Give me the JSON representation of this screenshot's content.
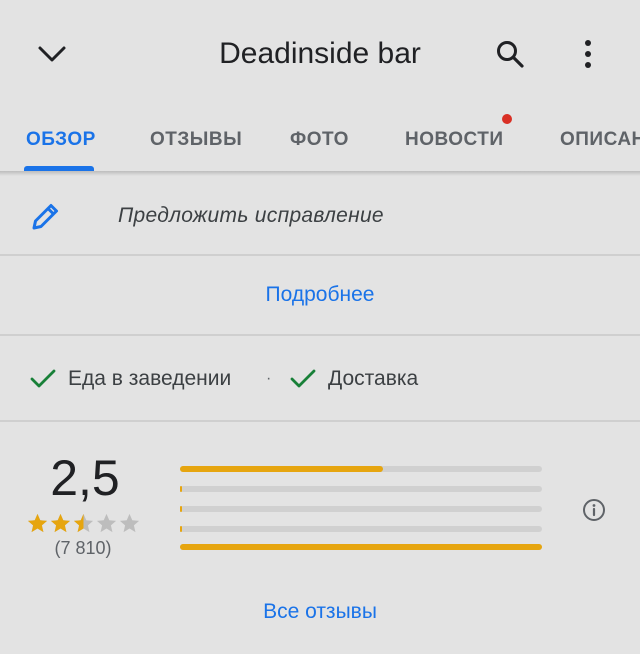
{
  "header": {
    "title": "Deadinside bar",
    "back_icon": "chevron-down-icon",
    "search_icon": "search-icon",
    "more_icon": "more-vert-icon"
  },
  "tabs": [
    {
      "label": "ОБЗОР",
      "active": true
    },
    {
      "label": "ОТЗЫВЫ",
      "active": false
    },
    {
      "label": "ФОТО",
      "active": false
    },
    {
      "label": "НОВОСТИ",
      "active": false,
      "notification_dot": true
    },
    {
      "label": "ОПИСАН",
      "active": false
    }
  ],
  "suggest_edit": {
    "label": "Предложить исправление",
    "icon": "pencil-icon"
  },
  "details_link": "Подробнее",
  "features": [
    {
      "label": "Еда в заведении",
      "icon": "check-icon"
    },
    {
      "label": "Доставка",
      "icon": "check-icon"
    }
  ],
  "feature_separator": "·",
  "rating": {
    "score": "2,5",
    "stars": 2.5,
    "count": "(7 810)",
    "distribution": [
      0.56,
      0.005,
      0.005,
      0.005,
      1.0
    ]
  },
  "all_reviews_link": "Все отзывы",
  "colors": {
    "accent": "#1a73e8",
    "star": "#e6a50f",
    "check": "#188038",
    "notification": "#d93025"
  }
}
